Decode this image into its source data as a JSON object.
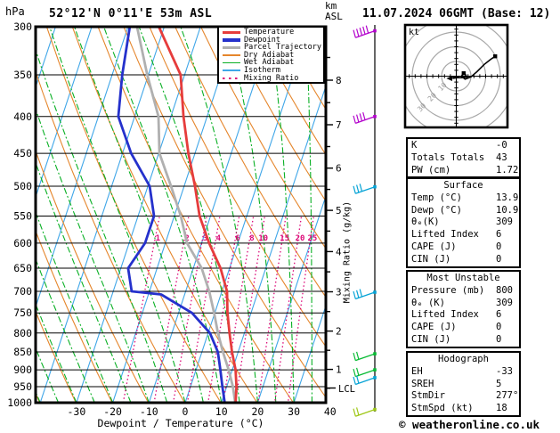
{
  "header": {
    "pressure_unit": "hPa",
    "title": "52°12'N 0°11'E 53m ASL",
    "date": "11.07.2024 06GMT (Base: 12)",
    "alt_unit_line1": "km",
    "alt_unit_line2": "ASL"
  },
  "axes": {
    "x_caption": "Dewpoint / Temperature (°C)",
    "mixing_ratio_axis_label": "Mixing Ratio (g/kg)",
    "lcl_label": "LCL"
  },
  "footer": {
    "copyright": "© weatheronline.co.uk"
  },
  "legend": {
    "items": [
      {
        "label": "Temperature",
        "color": "#e63c3c",
        "style": "thick"
      },
      {
        "label": "Dewpoint",
        "color": "#2531cc",
        "style": "thick"
      },
      {
        "label": "Parcel Trajectory",
        "color": "#b0b0b0",
        "style": "thick"
      },
      {
        "label": "Dry Adiabat",
        "color": "#e5862c",
        "style": "thin"
      },
      {
        "label": "Wet Adiabat",
        "color": "#0ab025",
        "style": "thin"
      },
      {
        "label": "Isotherm",
        "color": "#3fa6e8",
        "style": "thin"
      },
      {
        "label": "Mixing Ratio",
        "color": "#dc0a78",
        "style": "dotted"
      }
    ]
  },
  "chart_data": {
    "type": "line",
    "title": "Skew-T log-P sounding",
    "x_axis": {
      "label": "Dewpoint / Temperature (°C)",
      "ticks": [
        -30,
        -20,
        -10,
        0,
        10,
        20,
        30,
        40
      ],
      "range_c": [
        -41,
        39
      ]
    },
    "y_axis": {
      "label": "hPa",
      "scale": "log",
      "ticks": [
        300,
        350,
        400,
        450,
        500,
        550,
        600,
        650,
        700,
        750,
        800,
        850,
        900,
        950,
        1000
      ]
    },
    "altitude_axis_km": {
      "major_ticks": [
        8,
        7,
        6,
        5,
        4,
        3,
        2,
        1
      ],
      "extra_marker": "LCL",
      "lcl_pressure_hpa": 954
    },
    "mixing_ratio_lines_g_per_kg": [
      1,
      2,
      3,
      4,
      6,
      8,
      10,
      15,
      20,
      25
    ],
    "series": [
      {
        "name": "Temperature",
        "color_key": "temperature",
        "points_p_t": [
          [
            300,
            -41.5
          ],
          [
            350,
            -31.1
          ],
          [
            400,
            -26.5
          ],
          [
            450,
            -21.8
          ],
          [
            500,
            -17.0
          ],
          [
            550,
            -13.0
          ],
          [
            600,
            -7.9
          ],
          [
            650,
            -2.5
          ],
          [
            700,
            1.4
          ],
          [
            750,
            3.5
          ],
          [
            800,
            5.9
          ],
          [
            850,
            8.3
          ],
          [
            900,
            10.9
          ],
          [
            950,
            12.7
          ],
          [
            1000,
            13.9
          ]
        ]
      },
      {
        "name": "Dewpoint",
        "color_key": "dewpoint",
        "points_p_t": [
          [
            300,
            -49.5
          ],
          [
            350,
            -47.2
          ],
          [
            400,
            -44.5
          ],
          [
            450,
            -37.6
          ],
          [
            500,
            -29.5
          ],
          [
            550,
            -25.6
          ],
          [
            600,
            -25.6
          ],
          [
            650,
            -28.0
          ],
          [
            700,
            -24.9
          ],
          [
            707,
            -16.5
          ],
          [
            750,
            -6.3
          ],
          [
            800,
            0.5
          ],
          [
            850,
            4.4
          ],
          [
            900,
            6.7
          ],
          [
            950,
            8.8
          ],
          [
            1000,
            10.9
          ]
        ]
      },
      {
        "name": "Parcel Trajectory",
        "color_key": "parcel",
        "points_p_t": [
          [
            300,
            -47.5
          ],
          [
            350,
            -40.3
          ],
          [
            400,
            -33.4
          ],
          [
            450,
            -29.8
          ],
          [
            500,
            -23.6
          ],
          [
            550,
            -18.2
          ],
          [
            600,
            -14.0
          ],
          [
            650,
            -7.7
          ],
          [
            700,
            -3.5
          ],
          [
            750,
            -0.2
          ],
          [
            800,
            2.7
          ],
          [
            850,
            5.8
          ],
          [
            900,
            9.0
          ],
          [
            950,
            11.7
          ],
          [
            1000,
            13.8
          ]
        ]
      }
    ],
    "wind_barbs": [
      {
        "pressure": 304,
        "color_key": "barb_upper",
        "ticks": 5
      },
      {
        "pressure": 400,
        "color_key": "barb_upper",
        "ticks": 4
      },
      {
        "pressure": 501,
        "color_key": "barb_mid",
        "ticks": 3
      },
      {
        "pressure": 702,
        "color_key": "barb_mid",
        "ticks": 3
      },
      {
        "pressure": 855,
        "color_key": "barb_low",
        "ticks": 2
      },
      {
        "pressure": 900,
        "color_key": "barb_low",
        "ticks": 2
      },
      {
        "pressure": 923,
        "color_key": "barb_mid",
        "ticks": 2
      },
      {
        "pressure": 1022,
        "color_key": "barb_surface",
        "ticks": 2
      }
    ]
  },
  "hodograph": {
    "unit_label": "kt",
    "ring_interval_kt": 10,
    "ring_labels": [
      "10",
      "20",
      "30"
    ],
    "trace_kt": [
      [
        -2.5,
        -1.5
      ],
      [
        0.5,
        -1
      ],
      [
        4,
        -1
      ],
      [
        7,
        -0.5
      ],
      [
        5.5,
        2.5
      ],
      [
        3.5,
        0
      ],
      [
        6,
        -2
      ],
      [
        10,
        -0.5
      ],
      [
        14,
        3
      ],
      [
        19,
        8
      ],
      [
        23.5,
        11.5
      ],
      [
        26.5,
        13.5
      ]
    ],
    "markers_kt": [
      [
        5,
        2
      ],
      [
        26.5,
        13.5
      ]
    ],
    "storm_arrow_from_kt": [
      2,
      0
    ],
    "storm_arrow_to_kt": [
      -5.5,
      -1.5
    ]
  },
  "tables": [
    {
      "header": null,
      "rows": [
        [
          "K",
          "-0"
        ],
        [
          "Totals Totals",
          "43"
        ],
        [
          "PW (cm)",
          "1.72"
        ]
      ]
    },
    {
      "header": "Surface",
      "rows": [
        [
          "Temp (°C)",
          "13.9"
        ],
        [
          "Dewp (°C)",
          "10.9"
        ],
        [
          "θₑ(K)",
          "309"
        ],
        [
          "Lifted Index",
          "6"
        ],
        [
          "CAPE (J)",
          "0"
        ],
        [
          "CIN (J)",
          "0"
        ]
      ]
    },
    {
      "header": "Most Unstable",
      "rows": [
        [
          "Pressure (mb)",
          "800"
        ],
        [
          "θₑ (K)",
          "309"
        ],
        [
          "Lifted Index",
          "6"
        ],
        [
          "CAPE (J)",
          "0"
        ],
        [
          "CIN (J)",
          "0"
        ]
      ]
    },
    {
      "header": "Hodograph",
      "rows": [
        [
          "EH",
          "-33"
        ],
        [
          "SREH",
          "5"
        ],
        [
          "StmDir",
          "277°"
        ],
        [
          "StmSpd (kt)",
          "18"
        ]
      ]
    }
  ],
  "colors": {
    "temperature": "#e63c3c",
    "dewpoint": "#2531cc",
    "parcel": "#b0b0b0",
    "dry_adiabat": "#e5862c",
    "wet_adiabat": "#0ab025",
    "isotherm": "#3fa6e8",
    "mixing_ratio": "#dc0a78",
    "grid": "#000000",
    "barb_upper": "#b303cc",
    "barb_mid": "#06a3d6",
    "barb_low": "#07bb33",
    "barb_surface": "#9ec716",
    "hodograph_rings": "#a8a8a8"
  }
}
